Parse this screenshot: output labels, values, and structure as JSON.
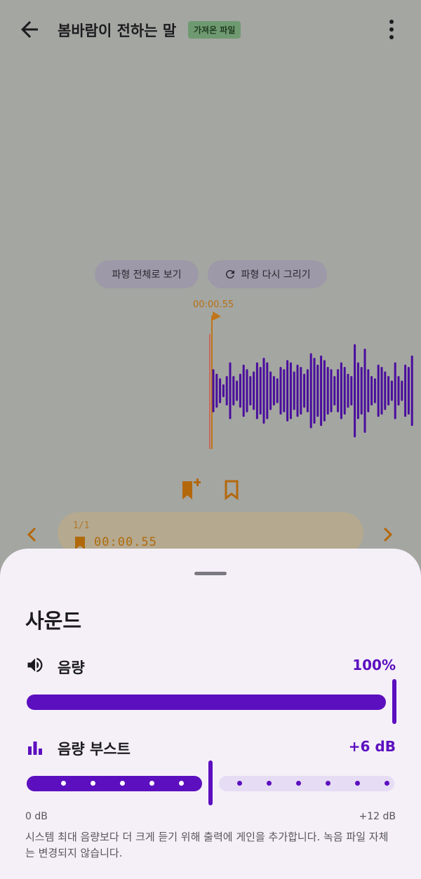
{
  "header": {
    "title": "봄바람이 전하는 말",
    "badge": "가져온 파일"
  },
  "waveform": {
    "fit_button": "파형 전체로 보기",
    "redraw_button": "파형 다시 그리기",
    "playhead_time": "00:00.55"
  },
  "markers": {
    "count": "1/1",
    "time": "00:00.55"
  },
  "sound_sheet": {
    "title": "사운드",
    "volume": {
      "label": "음량",
      "value": "100%",
      "level": 1.0
    },
    "boost": {
      "label": "음량 부스트",
      "value": "+6 dB",
      "level": 0.5,
      "min_label": "0 dB",
      "max_label": "+12 dB",
      "description": "시스템 최대 음량보다 더 크게 듣기 위해 출력에 게인을 추가합니다. 녹음 파일 자체는 변경되지 않습니다."
    }
  },
  "icons": {
    "back": "arrow-left-icon",
    "more": "more-vert-icon",
    "refresh": "refresh-icon",
    "bookmark_add": "bookmark-add-icon",
    "bookmark": "bookmark-icon",
    "prev": "chevron-left-icon",
    "next": "chevron-right-icon",
    "volume": "volume-icon",
    "boost": "bar-chart-icon"
  },
  "colors": {
    "accent": "#5c0fbf",
    "marker": "#b57014",
    "badge_bg": "#6f9a71"
  }
}
